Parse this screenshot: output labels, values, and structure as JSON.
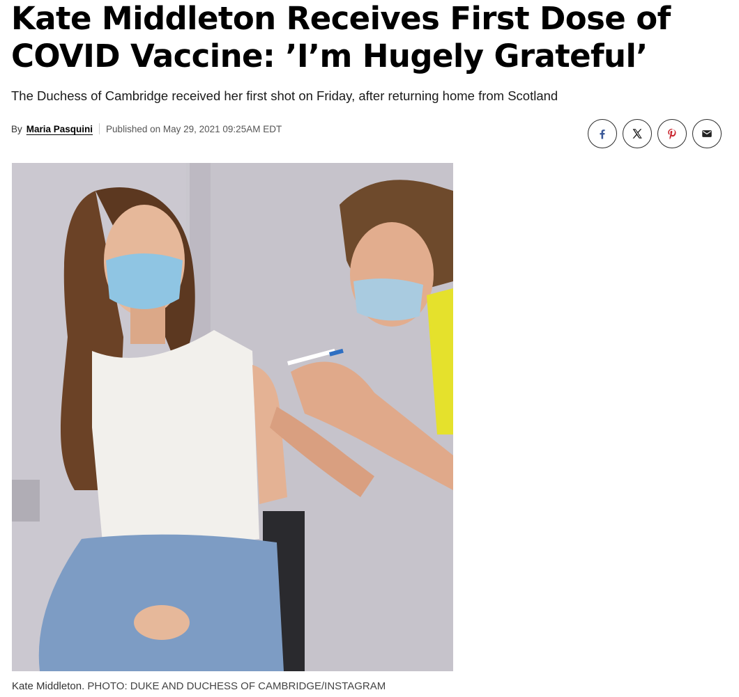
{
  "article": {
    "headline": "Kate Middleton Receives First Dose of COVID Vaccine: ’I’m Hugely Grateful’",
    "subhead": "The Duchess of Cambridge received her first shot on Friday, after returning home from Scotland",
    "byline": {
      "by_label": "By",
      "author": "Maria Pasquini",
      "published": "Published on May 29, 2021 09:25AM EDT"
    }
  },
  "share": {
    "buttons": [
      {
        "name": "facebook",
        "icon": "facebook-icon"
      },
      {
        "name": "x",
        "icon": "x-icon"
      },
      {
        "name": "pinterest",
        "icon": "pinterest-icon"
      },
      {
        "name": "email",
        "icon": "email-icon"
      }
    ],
    "colors": {
      "facebook": "#3b5998",
      "x": "#111111",
      "pinterest": "#c8232c",
      "email": "#222222"
    }
  },
  "photo": {
    "caption_subject": "Kate Middleton.",
    "caption_credit": "PHOTO: DUKE AND DUCHESS OF CAMBRIDGE/INSTAGRAM"
  }
}
